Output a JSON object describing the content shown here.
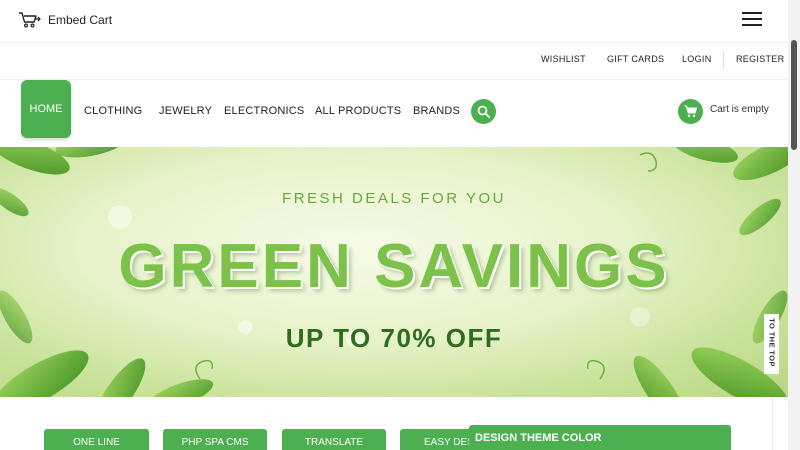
{
  "brand": {
    "name": "Embed Cart",
    "icon": "shopping-cart-icon"
  },
  "utility_links": [
    "WISHLIST",
    "GIFT CARDS",
    "LOGIN",
    "REGISTER"
  ],
  "nav": {
    "home": "HOME",
    "items": [
      "CLOTHING",
      "JEWELRY",
      "ELECTRONICS",
      "ALL PRODUCTS",
      "BRANDS"
    ],
    "search_icon": "search-icon",
    "cart_icon": "cart-icon",
    "cart_status": "Cart is empty"
  },
  "hero": {
    "tagline": "FRESH DEALS FOR YOU",
    "title": "GREEN SAVINGS",
    "subtitle": "UP TO 70% OFF"
  },
  "side_tab": "TO THE TOP",
  "plugins": [
    "ONE LINE",
    "PHP SPA CMS",
    "TRANSLATE",
    "EASY DESI"
  ],
  "theme_panel": {
    "title": "DESIGN THEME COLOR"
  },
  "colors": {
    "accent": "#4caf50",
    "hero_title": "#7cc24a",
    "hero_sub": "#2f6d1e"
  }
}
